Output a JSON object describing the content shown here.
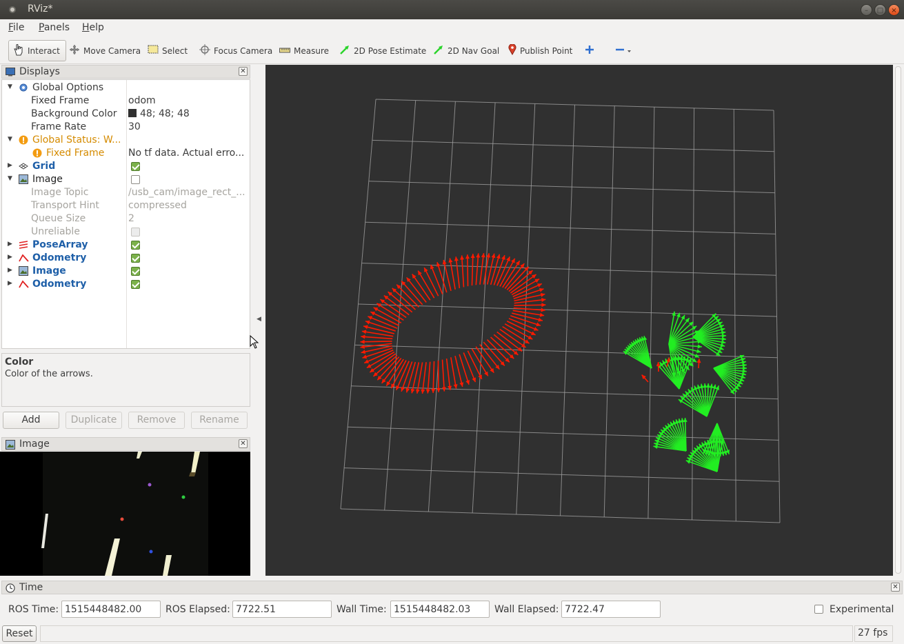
{
  "window": {
    "title": "RViz*"
  },
  "menu": {
    "file": "File",
    "panels": "Panels",
    "help": "Help"
  },
  "toolbar": {
    "interact": "Interact",
    "move_camera": "Move Camera",
    "select": "Select",
    "focus_camera": "Focus Camera",
    "measure": "Measure",
    "pose_estimate": "2D Pose Estimate",
    "nav_goal": "2D Nav Goal",
    "publish_point": "Publish Point"
  },
  "displays": {
    "title": "Displays",
    "global_options": "Global Options",
    "fixed_frame_label": "Fixed Frame",
    "fixed_frame_value": "odom",
    "bg_color_label": "Background Color",
    "bg_color_value": "48; 48; 48",
    "frame_rate_label": "Frame Rate",
    "frame_rate_value": "30",
    "global_status": "Global Status: W...",
    "status_fixed_frame": "Fixed Frame",
    "status_fixed_frame_value": "No tf data.  Actual erro...",
    "grid": "Grid",
    "image": "Image",
    "image_topic_label": "Image Topic",
    "image_topic_value": "/usb_cam/image_rect_...",
    "transport_hint_label": "Transport Hint",
    "transport_hint_value": "compressed",
    "queue_size_label": "Queue Size",
    "queue_size_value": "2",
    "unreliable_label": "Unreliable",
    "pose_array": "PoseArray",
    "odometry": "Odometry",
    "image2": "Image",
    "odometry2": "Odometry",
    "checked": {
      "grid": true,
      "image": false,
      "unreliable": false,
      "pose_array": true,
      "odometry": true,
      "image2": true,
      "odometry2": true
    }
  },
  "description": {
    "title": "Color",
    "text": "Color of the arrows."
  },
  "buttons": {
    "add": "Add",
    "duplicate": "Duplicate",
    "remove": "Remove",
    "rename": "Rename"
  },
  "image_panel": {
    "title": "Image"
  },
  "time": {
    "title": "Time",
    "ros_time_label": "ROS Time:",
    "ros_time": "1515448482.00",
    "ros_elapsed_label": "ROS Elapsed:",
    "ros_elapsed": "7722.51",
    "wall_time_label": "Wall Time:",
    "wall_time": "1515448482.03",
    "wall_elapsed_label": "Wall Elapsed:",
    "wall_elapsed": "7722.47",
    "experimental": "Experimental"
  },
  "status": {
    "reset": "Reset",
    "fps": "27 fps"
  },
  "colors": {
    "background": "#303030",
    "grid": "#a0a0a0",
    "pose_array": "#ff1a00",
    "odometry": "#22ee22"
  },
  "icons": [
    "interact-icon",
    "move-camera-icon",
    "select-icon",
    "focus-camera-icon",
    "measure-icon",
    "pose-estimate-icon",
    "nav-goal-icon",
    "publish-point-icon",
    "add-tool-icon",
    "remove-tool-icon"
  ]
}
